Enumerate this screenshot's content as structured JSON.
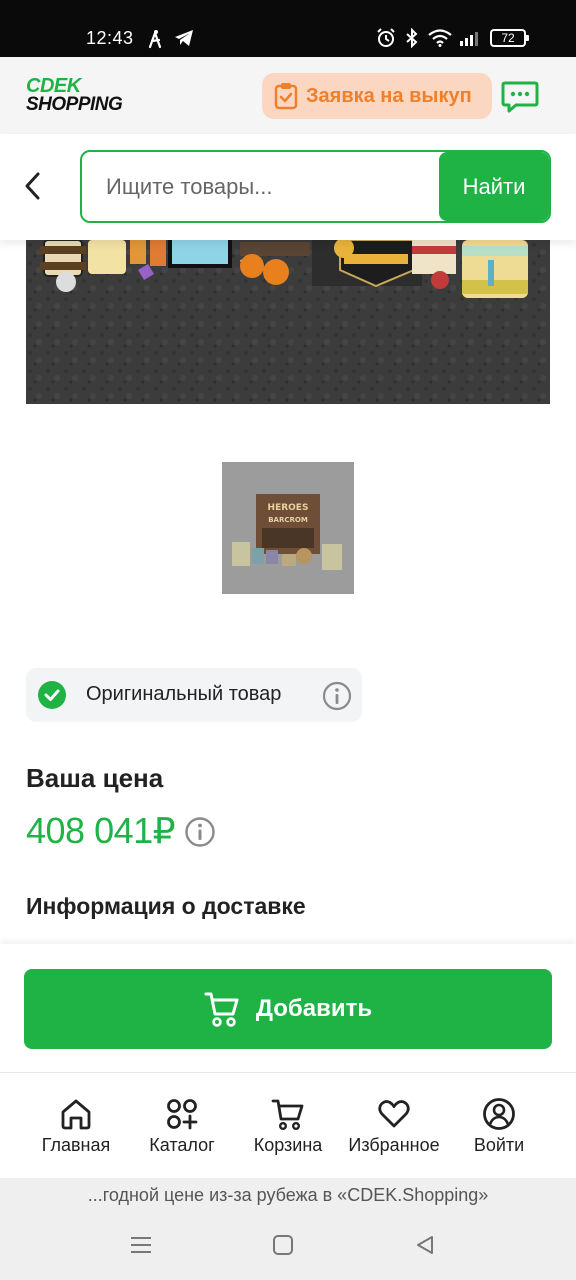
{
  "status_bar": {
    "time": "12:43",
    "battery": "72"
  },
  "header": {
    "logo_line1": "CDEK",
    "logo_line2": "SHOPPING",
    "buyout_label": "Заявка на выкуп"
  },
  "search": {
    "placeholder": "Ищите товары...",
    "button_label": "Найти"
  },
  "product": {
    "thumbnail_title_line1": "HEROES",
    "thumbnail_title_line2": "BARCROM",
    "original_label": "Оригинальный товар",
    "price_label": "Ваша цена",
    "price_value": "408 041₽",
    "delivery_title": "Информация о доставке"
  },
  "actions": {
    "add_label": "Добавить"
  },
  "bottom_nav": {
    "items": [
      {
        "label": "Главная",
        "icon": "home-icon"
      },
      {
        "label": "Каталог",
        "icon": "catalog-icon"
      },
      {
        "label": "Корзина",
        "icon": "cart-icon"
      },
      {
        "label": "Избранное",
        "icon": "heart-icon"
      },
      {
        "label": "Войти",
        "icon": "user-icon"
      }
    ]
  },
  "url_hint": "...годной цене из-за рубежа в «CDEK.Shopping»",
  "colors": {
    "brand_green": "#1fb346",
    "buyout_bg": "#fbd7c2",
    "buyout_text": "#f07f2a"
  }
}
